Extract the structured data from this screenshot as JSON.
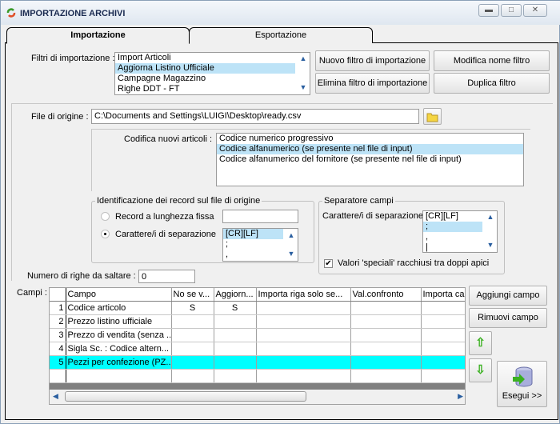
{
  "window": {
    "title": "IMPORTAZIONE ARCHIVI",
    "controls": [
      "minimize",
      "maximize",
      "close"
    ]
  },
  "tabs": [
    {
      "label": "Importazione",
      "active": true
    },
    {
      "label": "Esportazione",
      "active": false
    }
  ],
  "filters": {
    "label": "Filtri di importazione :",
    "items": [
      "Import Articoli",
      "Aggiorna Listino Ufficiale",
      "Campagne Magazzino",
      "Righe DDT - FT"
    ],
    "selected": 1,
    "buttons": {
      "new": "Nuovo filtro di importazione",
      "rename": "Modifica nome filtro",
      "delete": "Elimina filtro di importazione",
      "duplicate": "Duplica filtro"
    }
  },
  "file": {
    "label": "File di origine :",
    "value": "C:\\Documents and Settings\\LUIGI\\Desktop\\ready.csv",
    "browse_icon": "folder-icon"
  },
  "codifica": {
    "label": "Codifica nuovi articoli :",
    "items": [
      "Codice numerico progressivo",
      "Codice alfanumerico (se presente nel file di input)",
      "Codice alfanumerico del fornitore (se presente nel file di input)"
    ],
    "selected": 1
  },
  "identificazione": {
    "title": "Identificazione dei record sul file di origine",
    "fixed_label": "Record a lunghezza fissa",
    "fixed_value": "",
    "sep_label": "Carattere/i di separazione",
    "sep_items": [
      "[CR][LF]",
      ";",
      ","
    ],
    "selected_option": "separator"
  },
  "separatore": {
    "title": "Separatore campi",
    "label": "Carattere/i di separazione",
    "items": [
      "[CR][LF]",
      ";",
      ",",
      "|"
    ],
    "selected": 1,
    "checkbox_label": "Valori 'speciali' racchiusi tra doppi apici",
    "checkbox_checked": true
  },
  "skip": {
    "label": "Numero di righe da saltare :",
    "value": "0"
  },
  "grid": {
    "label": "Campi :",
    "columns": [
      "Campo",
      "No se v...",
      "Aggiorn...",
      "Importa riga solo se...",
      "Val.confronto",
      "Importa ca"
    ],
    "rows": [
      [
        "1",
        "Codice articolo",
        "S",
        "S",
        "",
        "",
        ""
      ],
      [
        "2",
        "Prezzo listino ufficiale",
        "",
        "",
        "",
        "",
        ""
      ],
      [
        "3",
        "Prezzo di vendita (senza ...",
        "",
        "",
        "",
        "",
        ""
      ],
      [
        "4",
        "Sigla Sc. : Codice altern...",
        "",
        "",
        "",
        "",
        ""
      ],
      [
        "5",
        "Pezzi per confezione (PZ...",
        "",
        "",
        "",
        "",
        ""
      ]
    ],
    "selected_row": 4,
    "highlight_color": "#00ffff"
  },
  "actions": {
    "add": "Aggiungi campo",
    "remove": "Rimuovi campo",
    "up_icon": "arrow-up-icon",
    "down_icon": "arrow-down-icon",
    "run": "Esegui >>",
    "run_icon": "database-icon"
  }
}
